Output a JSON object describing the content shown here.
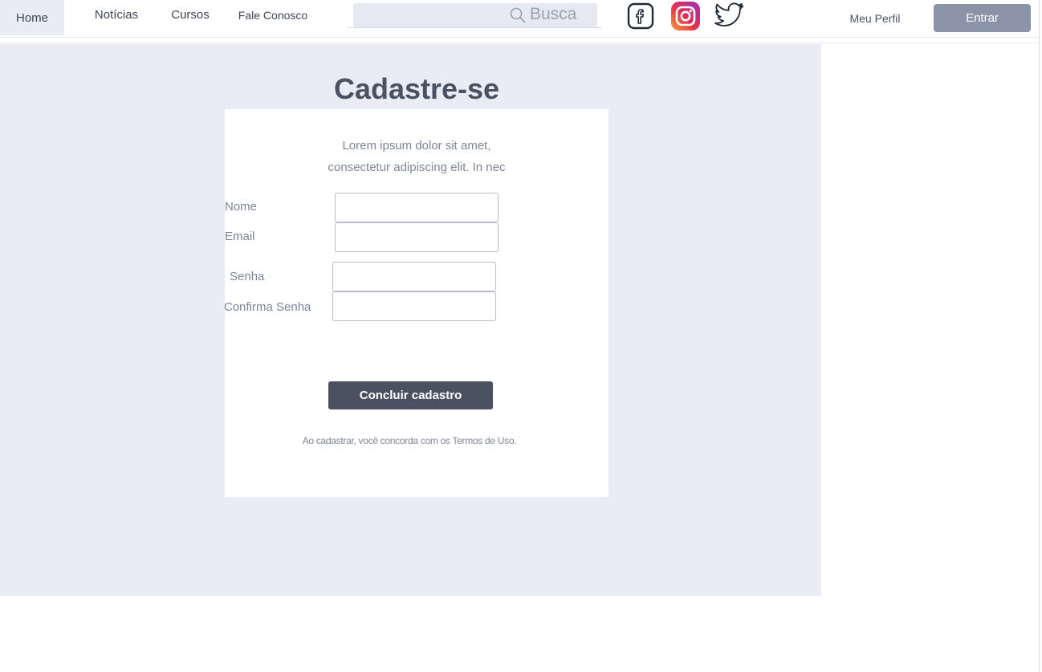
{
  "nav": {
    "items": [
      {
        "label": "Home"
      },
      {
        "label": "Notícias"
      },
      {
        "label": "Cursos"
      },
      {
        "label": "Fale Conosco"
      }
    ],
    "search_text": "Busca",
    "social": [
      "facebook-icon",
      "instagram-icon",
      "twitter-icon"
    ],
    "profile_label": "Meu Perfil",
    "login_label": "Entrar"
  },
  "signup": {
    "title": "Cadastre-se",
    "intro_line1": "Lorem ipsum dolor sit amet,",
    "intro_line2": "consectetur adipiscing elit. In nec",
    "fields": [
      {
        "label": "Nome",
        "value": ""
      },
      {
        "label": "Email",
        "value": ""
      },
      {
        "label": "Senha",
        "value": ""
      },
      {
        "label": "Confirma Senha",
        "value": ""
      }
    ],
    "submit_label": "Concluir cadastro",
    "terms_text": "Ao cadastrar, você concorda com os Termos de Uso."
  },
  "colors": {
    "page_bg": "#e9ecf4",
    "card_bg": "#ffffff",
    "text": "#4a5262",
    "muted_text": "#7d8597",
    "login_button": "#8a93a8",
    "submit_button": "#4a5262"
  }
}
